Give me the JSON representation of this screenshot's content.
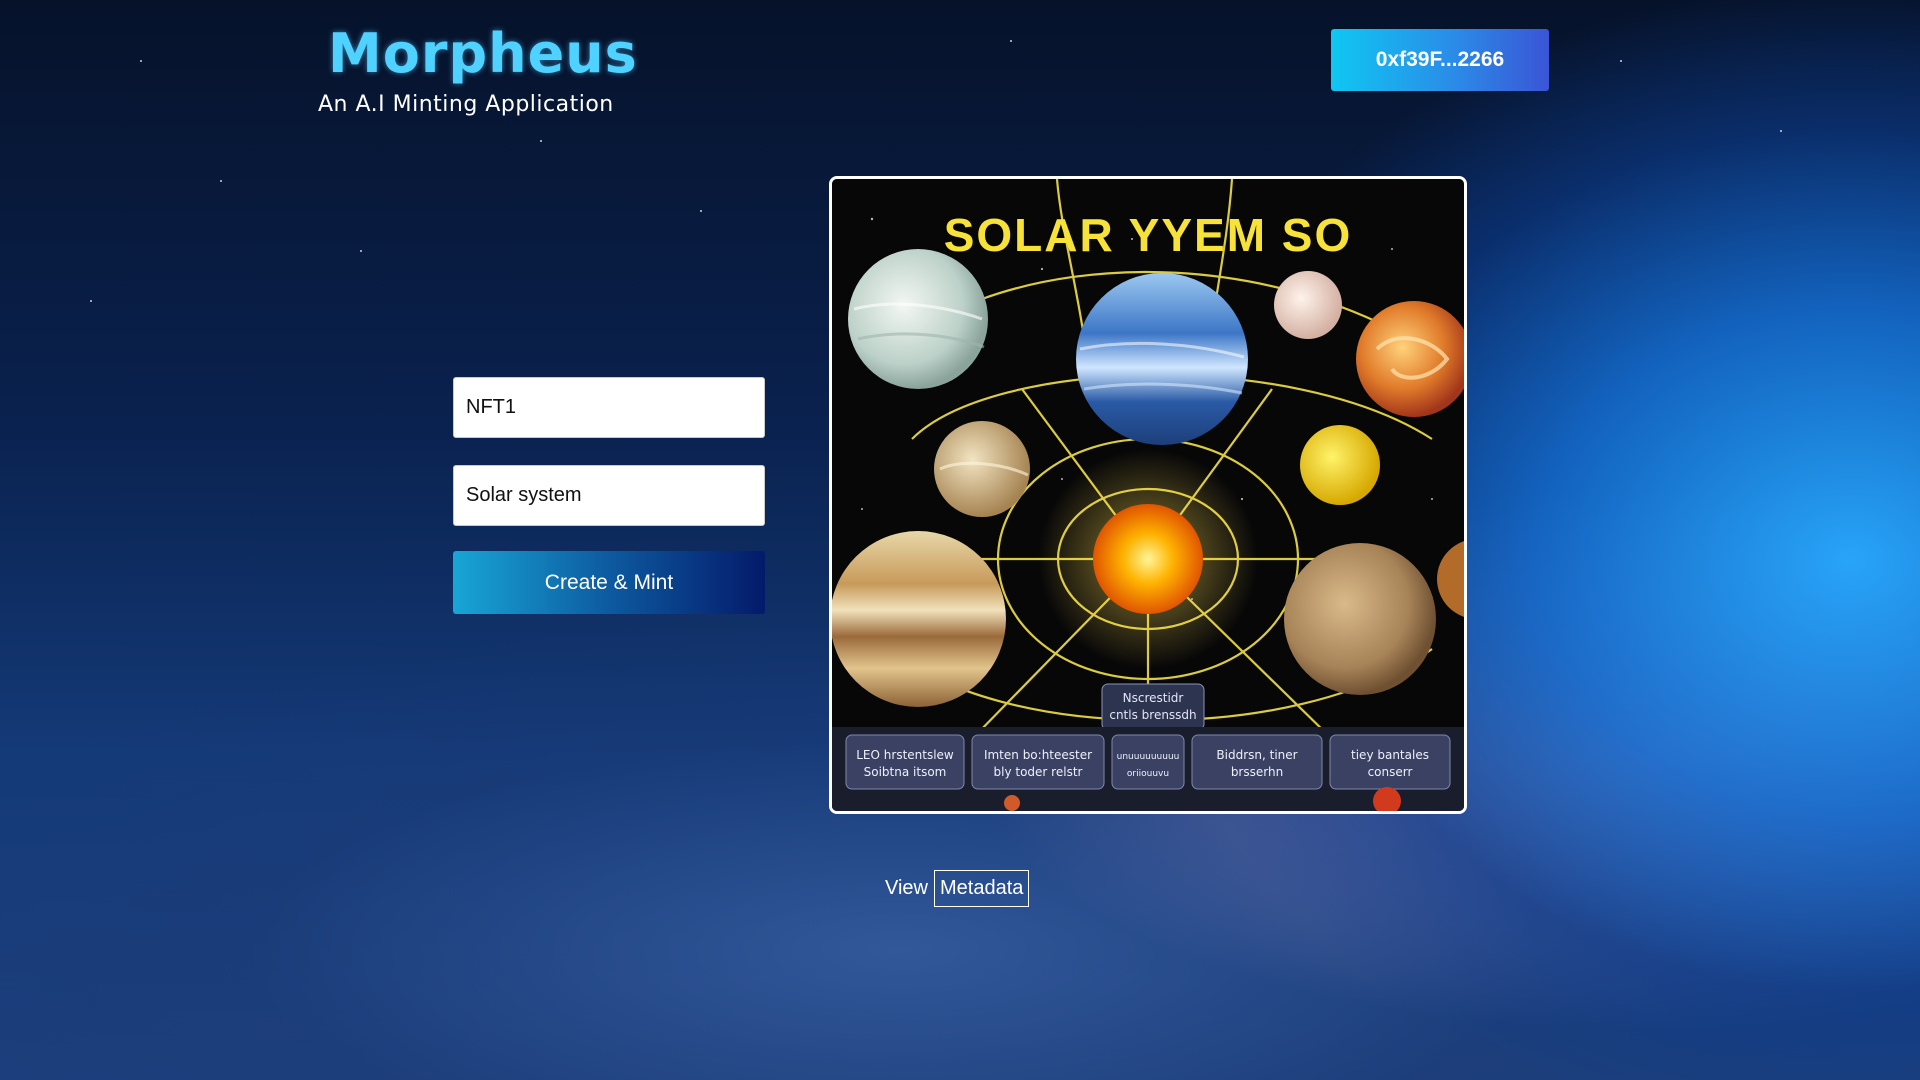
{
  "app": {
    "title": "Morpheus",
    "subtitle": "An A.I Minting Application"
  },
  "wallet": {
    "address_label": "0xf39F...2266"
  },
  "form": {
    "name_value": "NFT1",
    "description_value": "Solar system",
    "mint_button_label": "Create & Mint"
  },
  "generated_image": {
    "headline_text": "SOLAR YYEM SO",
    "caption_center_lines": [
      "Nscrestidr",
      "cntls brenssdh"
    ],
    "caption_panels": [
      [
        "LEO hrstentslew",
        "Soibtna itsom"
      ],
      [
        "Imten bo:hteester",
        "bly toder relstr"
      ],
      [
        "unuuuuuuuuu",
        "oriiouuvu"
      ],
      [
        "Biddrsn, tiner",
        "brsserhn"
      ],
      [
        "tiey bantales",
        "conserr"
      ]
    ]
  },
  "metadata": {
    "view_label": "View",
    "link_label": "Metadata"
  },
  "colors": {
    "brand_cyan": "#4fd2ff",
    "wallet_gradient_start": "#0fc7f2",
    "wallet_gradient_end": "#3a55d6",
    "mint_gradient_start": "#18a6d6",
    "mint_gradient_end": "#041a6a"
  }
}
